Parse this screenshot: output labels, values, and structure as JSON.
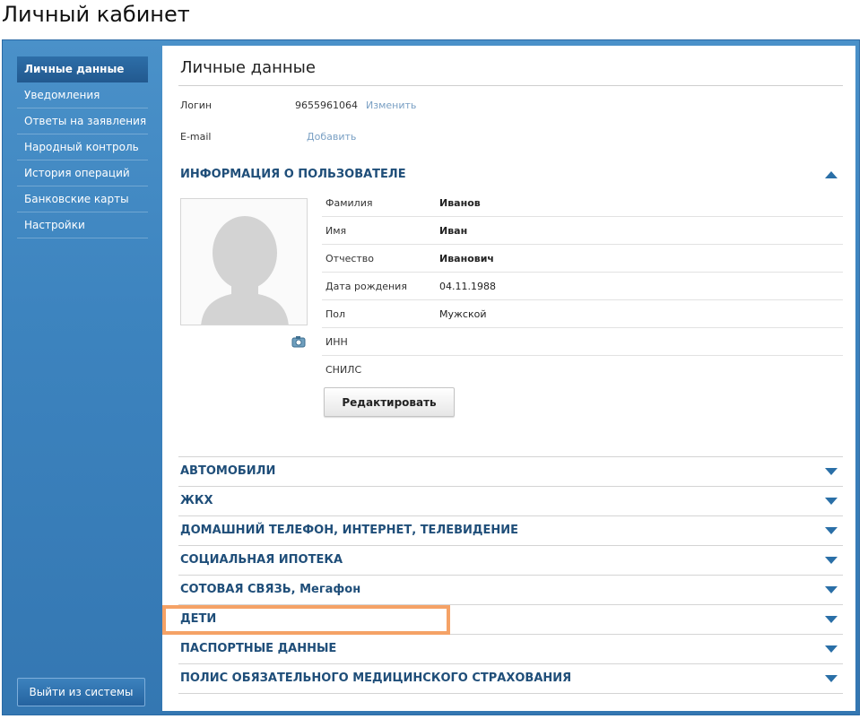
{
  "page": {
    "title": "Личный кабинет"
  },
  "sidebar": {
    "items": [
      {
        "label": "Личные данные"
      },
      {
        "label": "Уведомления"
      },
      {
        "label": "Ответы на заявления"
      },
      {
        "label": "Народный контроль"
      },
      {
        "label": "История операций"
      },
      {
        "label": "Банковские карты"
      },
      {
        "label": "Настройки"
      }
    ],
    "active_index": 0,
    "logout_label": "Выйти из системы"
  },
  "content": {
    "title": "Личные данные",
    "login": {
      "label": "Логин",
      "value": "9655961064",
      "action": "Изменить"
    },
    "email": {
      "label": "E-mail",
      "action": "Добавить"
    },
    "user_info": {
      "heading": "ИНФОРМАЦИЯ О ПОЛЬЗОВАТЕЛЕ",
      "expanded": true,
      "fields": [
        {
          "label": "Фамилия",
          "value": "Иванов"
        },
        {
          "label": "Имя",
          "value": "Иван"
        },
        {
          "label": "Отчество",
          "value": "Иванович"
        },
        {
          "label": "Дата рождения",
          "value": "04.11.1988"
        },
        {
          "label": "Пол",
          "value": "Мужской"
        },
        {
          "label": "ИНН",
          "value": ""
        },
        {
          "label": "СНИЛС",
          "value": ""
        }
      ],
      "edit_label": "Редактировать"
    },
    "sections": [
      {
        "label": "АВТОМОБИЛИ"
      },
      {
        "label": "ЖКХ"
      },
      {
        "label": "ДОМАШНИЙ ТЕЛЕФОН, ИНТЕРНЕТ, ТЕЛЕВИДЕНИЕ"
      },
      {
        "label": "СОЦИАЛЬНАЯ ИПОТЕКА"
      },
      {
        "label": "СОТОВАЯ СВЯЗЬ, Мегафон"
      },
      {
        "label": "ДЕТИ",
        "highlighted": true
      },
      {
        "label": "ПАСПОРТНЫЕ ДАННЫЕ"
      },
      {
        "label": "ПОЛИС ОБЯЗАТЕЛЬНОГО МЕДИЦИНСКОГО СТРАХОВАНИЯ"
      }
    ]
  },
  "colors": {
    "frame_blue": "#3d84bf",
    "heading_blue": "#1f4e79",
    "link": "#7aa0c4",
    "highlight_orange": "#f5a266"
  },
  "icons": {
    "collapse": "triangle-up-icon",
    "expand": "triangle-down-icon",
    "photo_upload": "camera-icon"
  }
}
